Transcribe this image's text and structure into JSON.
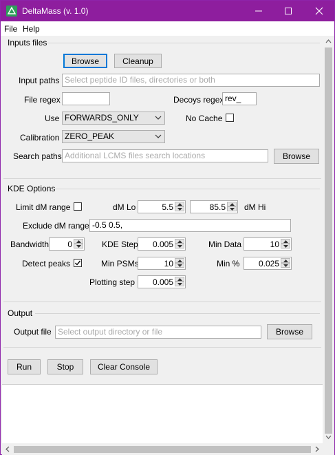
{
  "window": {
    "title": "DeltaMass (v. 1.0)"
  },
  "menu": {
    "file": "File",
    "help": "Help"
  },
  "inputs": {
    "section_title": "Inputs files",
    "browse_label": "Browse",
    "cleanup_label": "Cleanup",
    "input_paths_label": "Input paths",
    "input_paths_placeholder": "Select peptide ID files, directories or both",
    "file_regex_label": "File regex",
    "file_regex_value": "",
    "decoys_regex_label": "Decoys regex",
    "decoys_regex_value": "rev_",
    "use_label": "Use",
    "use_value": "FORWARDS_ONLY",
    "no_cache_label": "No Cache",
    "calibration_label": "Calibration",
    "calibration_value": "ZERO_PEAK",
    "search_paths_label": "Search paths",
    "search_paths_placeholder": "Additional LCMS files search locations",
    "search_browse_label": "Browse"
  },
  "kde": {
    "section_title": "KDE Options",
    "limit_dm_label": "Limit dM range",
    "dm_lo_label": "dM Lo",
    "dm_lo_value": "5.5",
    "dm_hi_value": "85.5",
    "dm_hi_label": "dM Hi",
    "exclude_label": "Exclude dM ranges",
    "exclude_value": "-0.5 0.5,",
    "bandwidth_label": "Bandwidth",
    "bandwidth_value": "0",
    "kde_step_label": "KDE Step",
    "kde_step_value": "0.005",
    "min_data_label": "Min Data",
    "min_data_value": "10",
    "detect_peaks_label": "Detect peaks",
    "min_psms_label": "Min PSMs",
    "min_psms_value": "10",
    "min_pct_label": "Min %",
    "min_pct_value": "0.025",
    "plotting_step_label": "Plotting step",
    "plotting_step_value": "0.005"
  },
  "output": {
    "section_title": "Output",
    "output_file_label": "Output file",
    "output_file_placeholder": "Select output directory or file",
    "browse_label": "Browse"
  },
  "actions": {
    "run": "Run",
    "stop": "Stop",
    "clear_console": "Clear Console"
  },
  "colors": {
    "titlebar": "#8e1e9e",
    "accent": "#0078d7"
  }
}
